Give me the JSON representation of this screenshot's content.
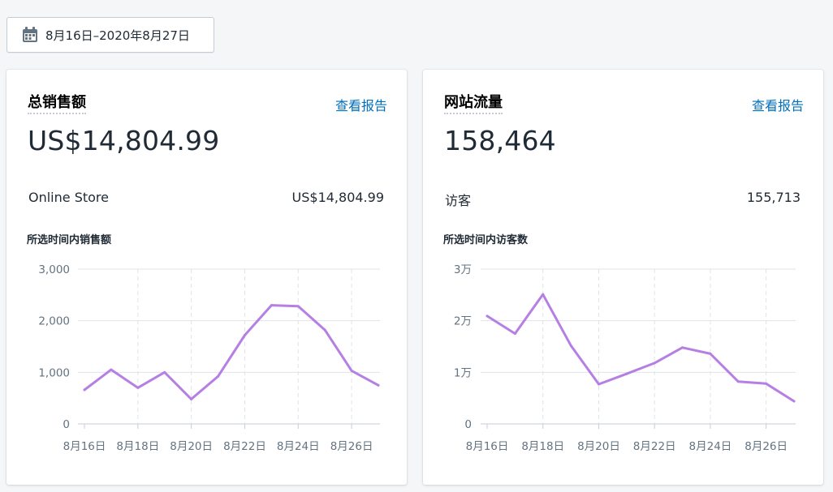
{
  "date_range": {
    "label": "8月16日–2020年8月27日",
    "icon": "calendar-icon"
  },
  "cards": [
    {
      "title": "总销售额",
      "link": "查看报告",
      "value": "US$14,804.99",
      "row_label": "Online Store",
      "row_value": "US$14,804.99",
      "subtitle": "所选时间内销售额"
    },
    {
      "title": "网站流量",
      "link": "查看报告",
      "value": "158,464",
      "row_label": "访客",
      "row_value": "155,713",
      "subtitle": "所选时间内访客数"
    }
  ],
  "colors": {
    "line": "#b57fe3",
    "link": "#006fbb",
    "grid": "#dfe3e8"
  },
  "chart_data": [
    {
      "type": "line",
      "x": [
        "8月16日",
        "8月17日",
        "8月18日",
        "8月19日",
        "8月20日",
        "8月21日",
        "8月22日",
        "8月23日",
        "8月24日",
        "8月25日",
        "8月26日",
        "8月27日"
      ],
      "x_tick_labels": [
        "8月16日",
        "8月18日",
        "8月20日",
        "8月22日",
        "8月24日",
        "8月26日"
      ],
      "y_tick_labels": [
        "0",
        "1,000",
        "2,000",
        "3,000"
      ],
      "ylim": [
        0,
        3000
      ],
      "series": [
        {
          "values": [
            660,
            1050,
            700,
            1000,
            480,
            920,
            1720,
            2300,
            2280,
            1820,
            1030,
            750
          ]
        }
      ],
      "grid": true
    },
    {
      "type": "line",
      "x": [
        "8月16日",
        "8月17日",
        "8月18日",
        "8月19日",
        "8月20日",
        "8月21日",
        "8月22日",
        "8月23日",
        "8月24日",
        "8月25日",
        "8月26日",
        "8月27日"
      ],
      "x_tick_labels": [
        "8月16日",
        "8月18日",
        "8月20日",
        "8月22日",
        "8月24日",
        "8月26日"
      ],
      "y_tick_labels": [
        "0",
        "1万",
        "2万",
        "3万"
      ],
      "ylim": [
        0,
        30000
      ],
      "series": [
        {
          "values": [
            20900,
            17500,
            25100,
            15200,
            7700,
            9700,
            11800,
            14800,
            13600,
            8200,
            7800,
            4400
          ]
        }
      ],
      "grid": true
    }
  ]
}
